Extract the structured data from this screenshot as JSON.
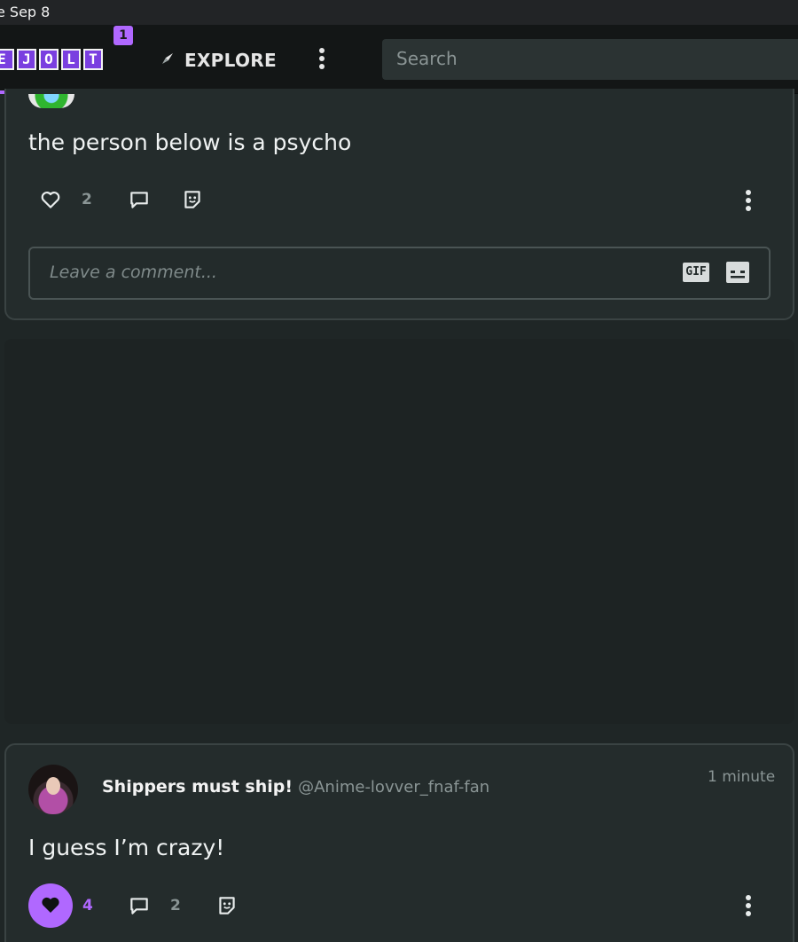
{
  "status_bar": {
    "text": "e Sep 8"
  },
  "nav": {
    "logo_text": "EJOLT",
    "notification_count": "1",
    "explore_label": "EXPLORE",
    "search_placeholder": "Search"
  },
  "post1": {
    "text": "the person below is a psycho",
    "like_count": "2",
    "comment_placeholder": "Leave a comment...",
    "gif_label": "GIF"
  },
  "post2": {
    "author_name": "Shippers must ship!",
    "author_handle": "@Anime-lovver_fnaf-fan",
    "timestamp": "1 minute",
    "text": "I guess I’m crazy!",
    "like_count": "4",
    "comment_count": "2",
    "liked": true
  },
  "colors": {
    "accent": "#b068ff",
    "background": "#1f2626",
    "card": "#242c2c",
    "nav": "#131616"
  },
  "icons": {
    "like": "heart-icon",
    "comment": "comment-bubble-icon",
    "sticker": "sticker-icon",
    "more": "more-vertical-icon",
    "explore": "compass-icon",
    "gif": "gif-icon",
    "emoji": "emoji-icon"
  }
}
